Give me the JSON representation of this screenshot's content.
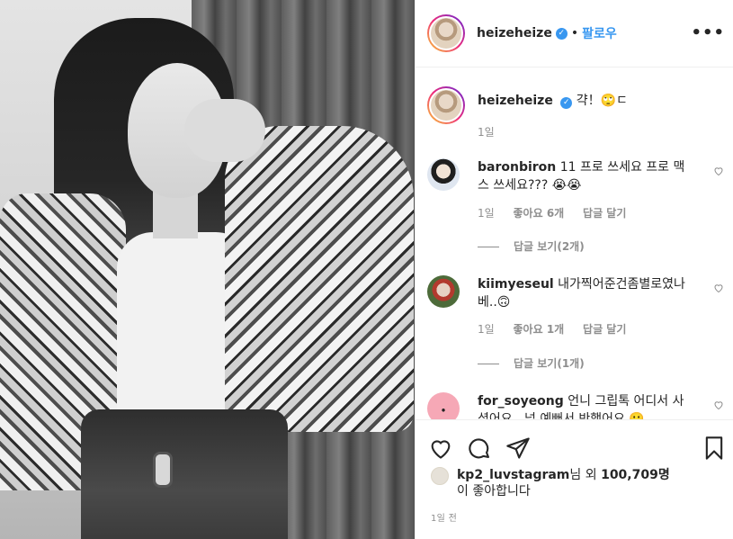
{
  "post": {
    "username": "heizeheize",
    "follow_label": "팔로우",
    "separator": "•",
    "more_label": "•••",
    "caption": "갹！🙄ㄷ",
    "caption_time": "1일"
  },
  "comments": [
    {
      "username": "baronbiron",
      "text": "11 프로 쓰세요 프로 맥스 쓰세요??? 😭😭",
      "time": "1일",
      "likes": "좋아요 6개",
      "reply": "답글 달기",
      "view_replies": "답글 보기(2개)"
    },
    {
      "username": "kiimyeseul",
      "text": "내가찍어준건좀별로였나베..🙃",
      "time": "1일",
      "likes": "좋아요 1개",
      "reply": "답글 달기",
      "view_replies": "답글 보기(1개)"
    },
    {
      "username": "for_soyeong",
      "text": "언니 그립톡 어디서 사셨어요.. 넘 예뻐서 반했어요 🙂"
    }
  ],
  "likes_row": {
    "liker": "kp2_luvstagram",
    "suffix": "님 외",
    "count": "100,709명",
    "line2": "이 좋아합니다"
  },
  "posted_time": "1일 전",
  "colors": {
    "accent": "#3897f0",
    "muted": "#8e8e8e",
    "text": "#262626"
  }
}
